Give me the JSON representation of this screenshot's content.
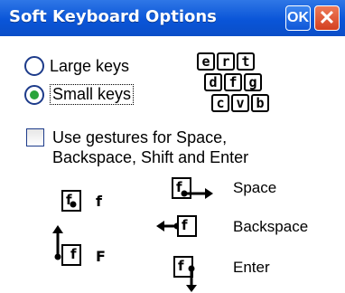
{
  "window": {
    "title": "Soft Keyboard Options",
    "ok_label": "OK",
    "close_label": "✕"
  },
  "key_size": {
    "large_label": "Large keys",
    "small_label": "Small keys",
    "selected": "small"
  },
  "keys_preview": {
    "row1": [
      "e",
      "r",
      "t"
    ],
    "row2": [
      "d",
      "f",
      "g"
    ],
    "row3": [
      "c",
      "v",
      "b"
    ]
  },
  "gestures": {
    "checked": false,
    "label": "Use gestures for Space, Backspace, Shift and Enter",
    "label_line1": "Use gestures for Space,",
    "label_line2": "Backspace, Shift and Enter",
    "items": [
      {
        "key": "f",
        "result": "f"
      },
      {
        "key": "f",
        "result": "F"
      },
      {
        "key": "f",
        "result": "Space"
      },
      {
        "key": "f",
        "result": "Backspace"
      },
      {
        "key": "f",
        "result": "Enter"
      }
    ]
  }
}
